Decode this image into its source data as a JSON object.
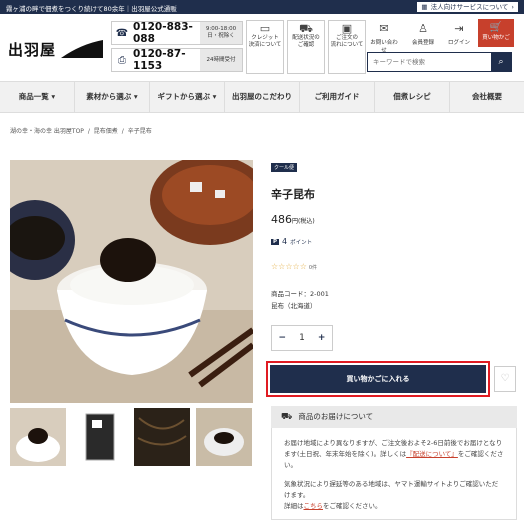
{
  "topbar": {
    "message": "霧ヶ浦の畔で佃煮をつくり続けて80余年｜出羽屋公式通販",
    "corporate": "法人向けサービスについて"
  },
  "logo": {
    "text": "出羽屋"
  },
  "phones": [
    {
      "icon": "phone-icon",
      "number": "0120-883-088",
      "hours_line1": "9:00-18:00",
      "hours_line2": "日・祝除く"
    },
    {
      "icon": "fax-icon",
      "number": "0120-87-1153",
      "hours_line1": "24時間受付",
      "hours_line2": ""
    }
  ],
  "header_boxes": [
    {
      "icon": "card-icon",
      "line1": "クレジット",
      "line2": "決済について"
    },
    {
      "icon": "truck-icon",
      "line1": "配送状況の",
      "line2": "ご確認"
    },
    {
      "icon": "box-icon",
      "line1": "ご注文の",
      "line2": "流れについて"
    }
  ],
  "header_icons": [
    {
      "icon": "mail-icon",
      "label": "お問い合わせ"
    },
    {
      "icon": "user-icon",
      "label": "会員登録"
    },
    {
      "icon": "login-icon",
      "label": "ログイン"
    }
  ],
  "cart": {
    "label": "買い物かご"
  },
  "search": {
    "placeholder": "キーワードで検索"
  },
  "nav": [
    "商品一覧 ▾",
    "素材から選ぶ ▾",
    "ギフトから選ぶ ▾",
    "出羽屋のこだわり",
    "ご利用ガイド",
    "佃煮レシピ",
    "会社概要"
  ],
  "breadcrumb": [
    "湖の幸・海の幸 出羽屋TOP",
    "/",
    "昆布佃煮",
    "/",
    "辛子昆布"
  ],
  "product": {
    "badge": "クール便",
    "title": "辛子昆布",
    "price": "486",
    "price_suffix": "円(税込)",
    "points_badge": "P",
    "points": "4",
    "points_unit": "ポイント",
    "stars": "☆☆☆☆☆",
    "reviews": "0件",
    "code": "商品コード：2-001",
    "origin": "昆布（北海道）",
    "qty": "1",
    "minus": "−",
    "plus": "+",
    "add_to_cart": "買い物かごに入れる",
    "favorite_icon": "♡"
  },
  "delivery": {
    "title": "商品のお届けについて",
    "p1a": "お届け地域により異なりますが、ご注文後およそ2-6日前後でお届けとなります(土日祝、年末年始を除く)。詳しくは",
    "p1link": "『配送について』",
    "p1b": "をご確認ください。",
    "p2": "気象状況により遅延等のある地域は、ヤマト運輸サイトよりご確認いただけます。",
    "p3a": "詳細は",
    "p3link": "こちら",
    "p3b": "をご確認ください。"
  },
  "colors": {
    "navy": "#1f2e4c",
    "red": "#c7402c",
    "highlight": "#e01b22"
  }
}
